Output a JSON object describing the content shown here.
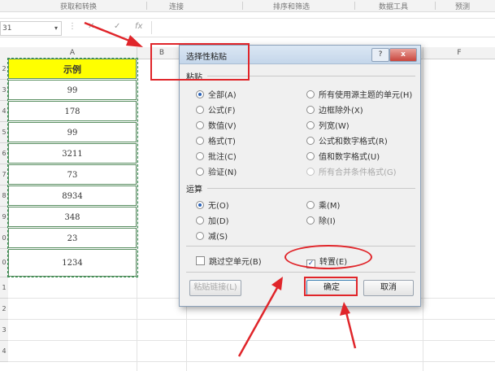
{
  "ribbon": {
    "groups": [
      "获取和转换",
      "连接",
      "排序和筛选",
      "数据工具",
      "预测"
    ]
  },
  "formula_bar": {
    "name_box": "31",
    "fx": "fx"
  },
  "columns": [
    "A",
    "B",
    "F"
  ],
  "rows": [
    "2",
    "3",
    "4",
    "5",
    "6",
    "7",
    "8",
    "9",
    "0",
    "1",
    "2",
    "3",
    "4"
  ],
  "sheet": {
    "header": "示例",
    "values": [
      "99",
      "178",
      "99",
      "3211",
      "73",
      "8934",
      "348",
      "23",
      "1234"
    ]
  },
  "dialog": {
    "title": "选择性粘贴",
    "help": "?",
    "close": "x",
    "paste_group": "粘贴",
    "paste_left": [
      {
        "label": "全部(A)",
        "checked": true
      },
      {
        "label": "公式(F)",
        "checked": false
      },
      {
        "label": "数值(V)",
        "checked": false
      },
      {
        "label": "格式(T)",
        "checked": false
      },
      {
        "label": "批注(C)",
        "checked": false
      },
      {
        "label": "验证(N)",
        "checked": false
      }
    ],
    "paste_right": [
      {
        "label": "所有使用源主题的单元(H)",
        "disabled": false
      },
      {
        "label": "边框除外(X)",
        "disabled": false
      },
      {
        "label": "列宽(W)",
        "disabled": false
      },
      {
        "label": "公式和数字格式(R)",
        "disabled": false
      },
      {
        "label": "值和数字格式(U)",
        "disabled": false
      },
      {
        "label": "所有合并条件格式(G)",
        "disabled": true
      }
    ],
    "operation_group": "运算",
    "op_left": [
      {
        "label": "无(O)",
        "checked": true
      },
      {
        "label": "加(D)",
        "checked": false
      },
      {
        "label": "减(S)",
        "checked": false
      }
    ],
    "op_right": [
      {
        "label": "乘(M)",
        "checked": false
      },
      {
        "label": "除(I)",
        "checked": false
      }
    ],
    "skip_blanks": "跳过空单元(B)",
    "transpose": "转置(E)",
    "transpose_checked": true,
    "paste_link": "粘贴链接(L)",
    "ok": "确定",
    "cancel": "取消"
  },
  "colors": {
    "header_fill": "#ffff00",
    "annotation": "#e0252a",
    "marquee": "#2f8a4a"
  }
}
